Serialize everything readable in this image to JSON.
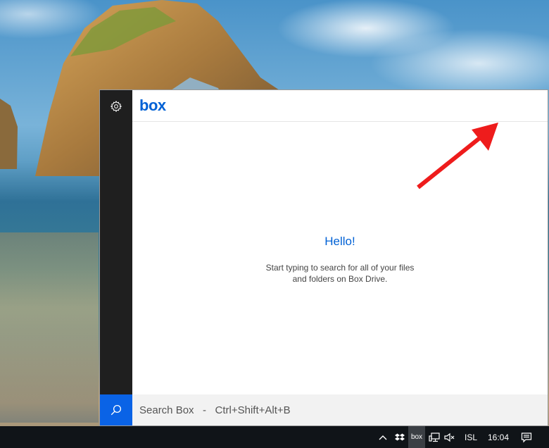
{
  "app": {
    "brand": "box"
  },
  "main": {
    "greeting": "Hello!",
    "description_line1": "Start typing to search for all of your files",
    "description_line2": "and folders on Box Drive."
  },
  "search": {
    "placeholder": "Search Box   -   Ctrl+Shift+Alt+B"
  },
  "taskbar": {
    "tray_box_label": "box",
    "language": "ISL",
    "time": "16:04"
  },
  "icons": {
    "settings": "gear-icon",
    "search": "search-icon",
    "show_hidden": "chevron-up-icon",
    "dropbox": "dropbox-icon",
    "network": "network-icon",
    "volume": "volume-muted-icon",
    "notifications": "notification-icon"
  },
  "colors": {
    "brand_blue": "#0061d5",
    "search_button": "#0a63e6",
    "sidebar": "#1f1f1f",
    "annotation_arrow": "#ee1c1c"
  }
}
